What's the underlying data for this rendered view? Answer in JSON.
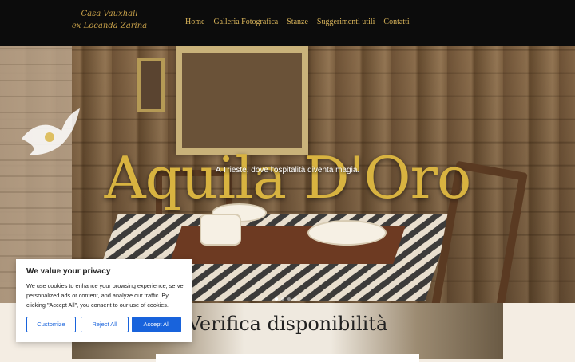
{
  "brand": {
    "line1": "Casa Vauxhall",
    "line2": "ex Locanda Zarina"
  },
  "nav": {
    "items": [
      {
        "label": "Home"
      },
      {
        "label": "Galleria Fotografica"
      },
      {
        "label": "Stanze"
      },
      {
        "label": "Suggerimenti utili"
      },
      {
        "label": "Contatti"
      }
    ],
    "color": "#d9b45a"
  },
  "hero": {
    "title": "Aquila D'Oro",
    "subtitle": "A Trieste, dove l'ospitalità diventa magia.",
    "title_color": "#d8b340",
    "slides_total": 4,
    "slide_active": 1
  },
  "availability": {
    "title": "Verifica disponibilità"
  },
  "cookie_banner": {
    "title": "We value your privacy",
    "text": "We use cookies to enhance your browsing experience, serve personalized ads or content, and analyze our traffic. By clicking \"Accept All\", you consent to our use of cookies.",
    "buttons": {
      "customize": "Customize",
      "reject": "Reject All",
      "accept": "Accept All"
    },
    "accent_color": "#1863dc"
  },
  "icons": {
    "logo_bird": "eagle-icon"
  }
}
